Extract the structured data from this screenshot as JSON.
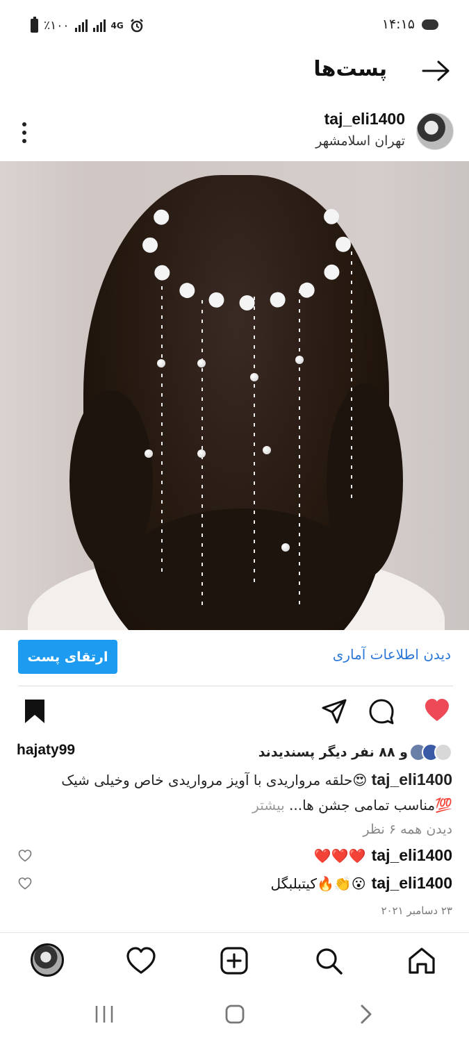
{
  "status_bar": {
    "battery_text": "٪۱۰۰",
    "network": "4G",
    "time": "۱۴:۱۵"
  },
  "header": {
    "title": "پست‌ها"
  },
  "post": {
    "username": "taj_eli1400",
    "location": "تهران اسلامشهر",
    "image_alt": "",
    "stats_link": "دیدن اطلاعات آماری",
    "promote_label": "ارتقای پست",
    "likes": {
      "text": "و ۸۸ نفر دیگر پسندیدند",
      "user": "hajaty99"
    },
    "caption": {
      "username": "taj_eli1400",
      "line1": "😍حلقه مرواریدی با آویز مرواریدی خاص وخیلی شیک",
      "line2": "💯مناسب تمامی جشن ها...",
      "more": "بیشتر"
    },
    "view_comments": "دیدن همه ۶ نظر",
    "comments": [
      {
        "username": "taj_eli1400",
        "text": "❤️❤️❤️"
      },
      {
        "username": "taj_eli1400",
        "text": "😮👏🔥کیتبلبگل"
      }
    ],
    "date": "۲۳ دسامبر ۲۰۲۱"
  },
  "colors": {
    "accent_blue": "#1d9bf0",
    "like_red": "#ed4956",
    "link_blue": "#2b77d9"
  },
  "icons": {
    "nav": [
      "home-icon",
      "search-icon",
      "add-post-icon",
      "activity-heart-icon",
      "profile-avatar"
    ],
    "actions": [
      "like-heart-icon",
      "comment-icon",
      "share-icon",
      "bookmark-icon"
    ]
  }
}
